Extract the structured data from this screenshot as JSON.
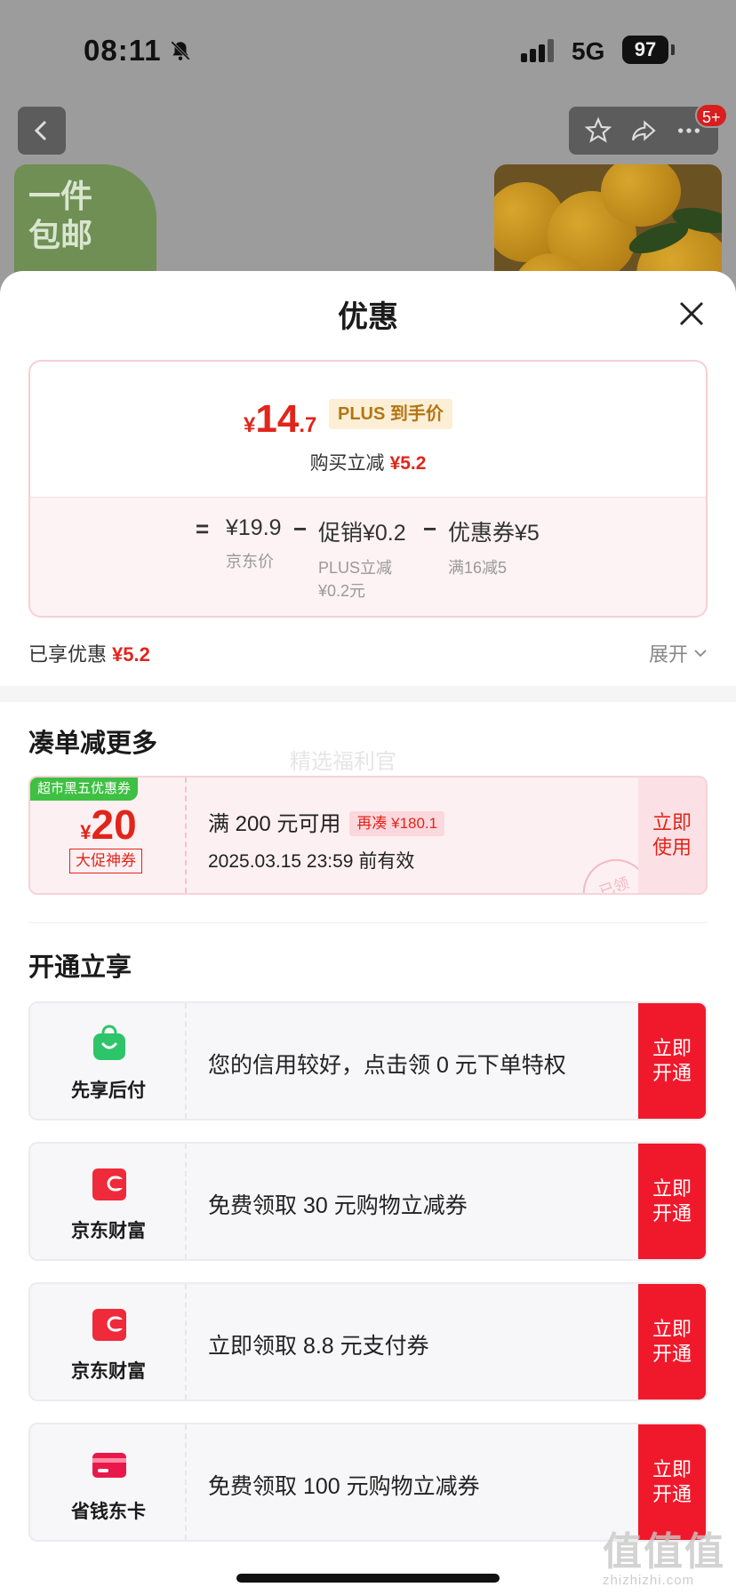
{
  "status_bar": {
    "time": "08:11",
    "network": "5G",
    "battery": "97"
  },
  "background_page": {
    "badge": "5+",
    "promo_banner_text": "一件\n包邮"
  },
  "sheet": {
    "title": "优惠",
    "price_card": {
      "currency": "¥",
      "price_integer": "14",
      "price_decimal": ".7",
      "plus_tag": "PLUS 到手价",
      "buy_reduce_label": "购买立减",
      "buy_reduce_value": "¥5.2",
      "formula": {
        "equals": "=",
        "items": [
          {
            "value": "¥19.9",
            "sub": "京东价"
          },
          {
            "value": "促销¥0.2",
            "sub": "PLUS立减\n¥0.2元"
          },
          {
            "value": "优惠券¥5",
            "sub": "满16减5"
          }
        ],
        "minus": "−"
      }
    },
    "enjoyed": {
      "label": "已享优惠",
      "value": "¥5.2",
      "expand": "展开"
    },
    "more_section": {
      "title": "凑单减更多",
      "watermark": "精选福利官",
      "coupon": {
        "tag": "超市黑五优惠券",
        "currency": "¥",
        "amount": "20",
        "label": "大促神券",
        "condition": "满 200 元可用",
        "more": "再凑 ¥180.1",
        "valid": "2025.03.15 23:59 前有效",
        "action": "立即\n使用",
        "stamp": "已领"
      }
    },
    "open_section": {
      "title": "开通立享",
      "items": [
        {
          "name": "先享后付",
          "desc": "您的信用较好，点击领 0 元下单特权",
          "action": "立即\n开通",
          "icon": "shopping-bag-icon"
        },
        {
          "name": "京东财富",
          "desc": "免费领取 30 元购物立减券",
          "action": "立即\n开通",
          "icon": "wallet-icon"
        },
        {
          "name": "京东财富",
          "desc": "立即领取 8.8 元支付券",
          "action": "立即\n开通",
          "icon": "wallet-icon"
        },
        {
          "name": "省钱东卡",
          "desc": "免费领取 100 元购物立减券",
          "action": "立即\n开通",
          "icon": "card-icon"
        }
      ]
    }
  },
  "site_mark": {
    "big": "值值值",
    "small": "zhizhizhi.com"
  },
  "colors": {
    "accent": "#e1251b",
    "button_red": "#f0192b",
    "plus_gold": "#b47613",
    "green_tag": "#3ec043"
  }
}
